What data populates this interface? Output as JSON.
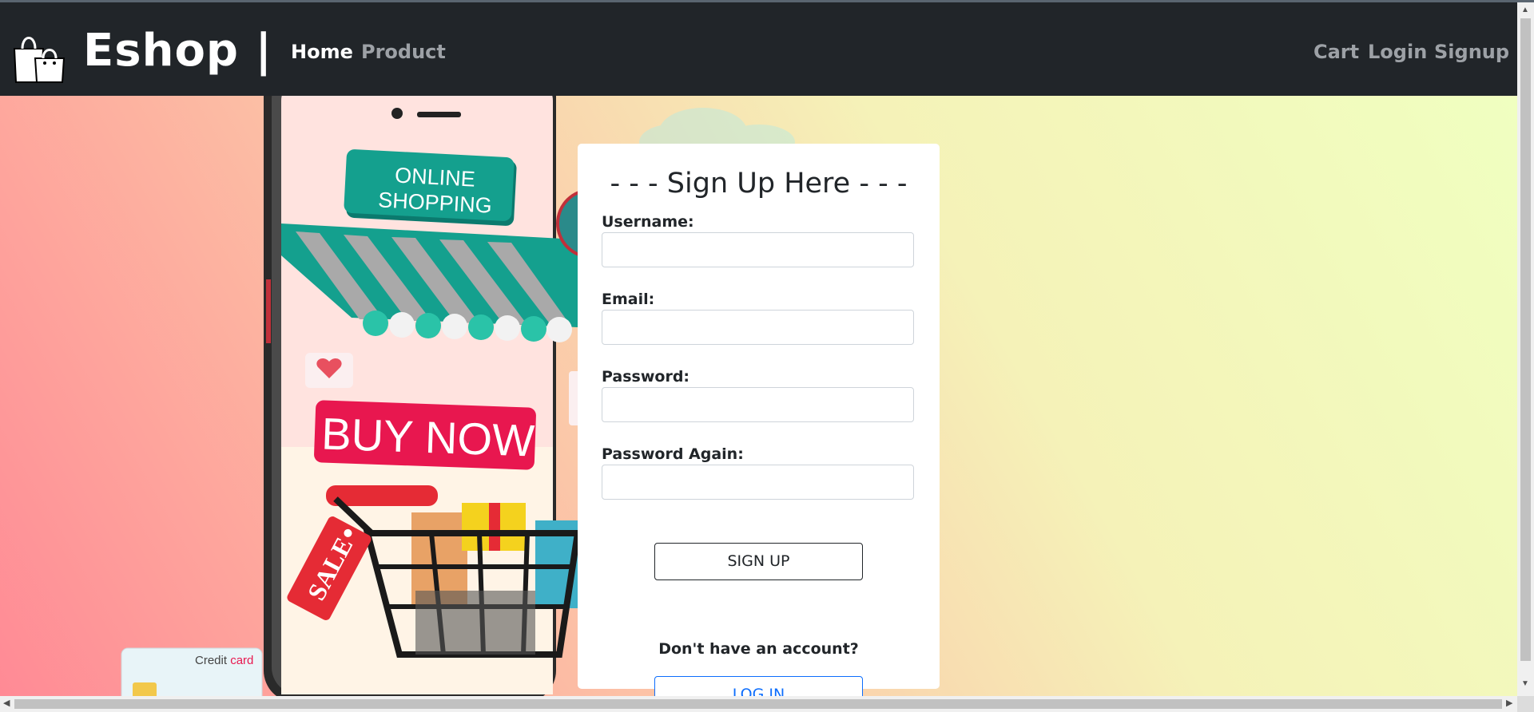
{
  "navbar": {
    "brand": "Eshop |",
    "logo_icon": "shopping-bags-icon",
    "links": [
      "Home",
      "Product"
    ],
    "right_links": [
      "Cart",
      "Login",
      "Signup"
    ]
  },
  "hero": {
    "sign_text": [
      "ONLINE",
      "SHOPPING"
    ],
    "buy_now": "BUY NOW",
    "sale_tag": "SALE",
    "credit_card": [
      "Credit",
      "card"
    ]
  },
  "form": {
    "title": "- - - Sign Up Here - - -",
    "fields": [
      {
        "label": "Username:",
        "value": ""
      },
      {
        "label": "Email:",
        "value": ""
      },
      {
        "label": "Password:",
        "value": ""
      },
      {
        "label": "Password Again:",
        "value": ""
      }
    ],
    "signup_button": "SIGN UP",
    "helper_text": "Don't have an account?",
    "login_button": "LOG IN"
  },
  "colors": {
    "navbar_bg": "#212529",
    "accent_teal": "#0f9a8a",
    "buy_now_red": "#e8174f",
    "login_blue": "#0d6efd"
  }
}
